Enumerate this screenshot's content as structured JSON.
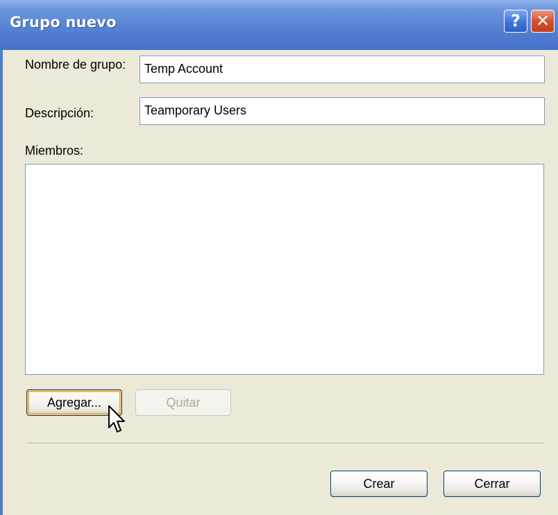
{
  "window": {
    "title": "Grupo nuevo",
    "help_glyph": "?",
    "close_glyph": "✕"
  },
  "form": {
    "group_name_label": "Nombre de grupo:",
    "group_name_value": "Temp Account",
    "description_label": "Descripción:",
    "description_value": "Teamporary Users",
    "members_label": "Miembros:",
    "members": []
  },
  "buttons": {
    "add": "Agregar...",
    "remove": "Quitar",
    "create": "Crear",
    "close": "Cerrar"
  },
  "colors": {
    "titlebar_accent": "#4f7ccf",
    "dialog_background": "#ece9d8",
    "button_border": "#003c74",
    "focus_highlight": "#f5c36a"
  },
  "icons": {
    "help": "help-icon",
    "close": "close-icon",
    "cursor": "mouse-pointer-icon"
  }
}
